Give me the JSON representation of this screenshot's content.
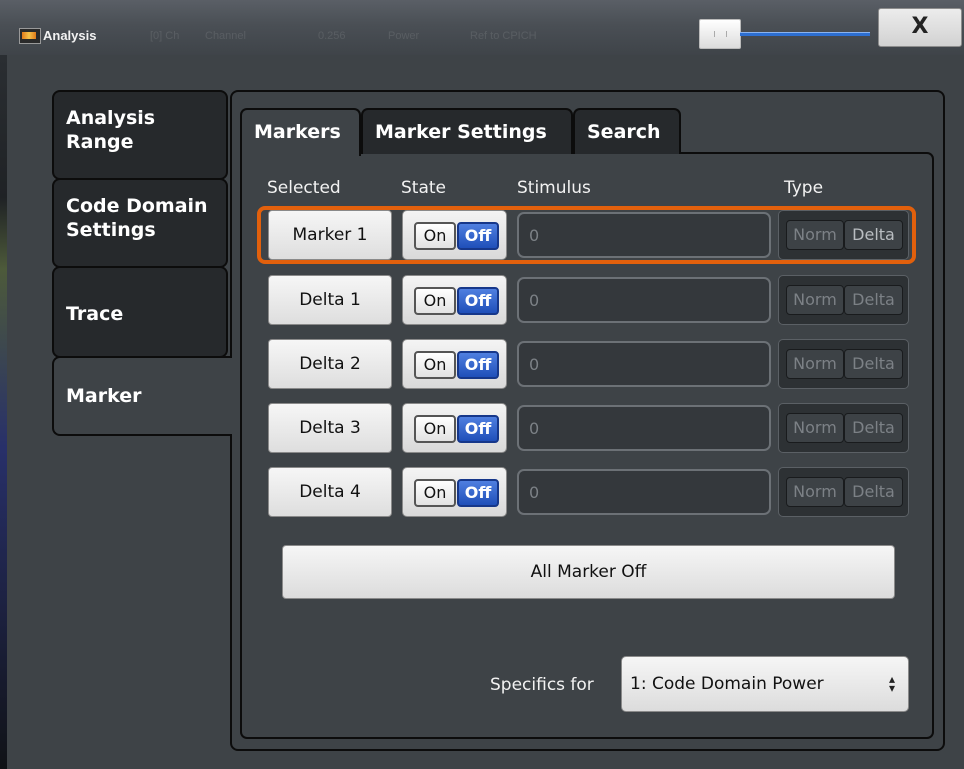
{
  "window": {
    "title": "Analysis",
    "close_label": "X"
  },
  "background_ghost_text": [
    "[0] Ch",
    "Channel",
    "0.256",
    "Power",
    "Ref to CPICH"
  ],
  "side_tabs": [
    {
      "label": "Analysis Range",
      "active": false
    },
    {
      "label": "Code Domain Settings",
      "active": false
    },
    {
      "label": "Trace",
      "active": false
    },
    {
      "label": "Marker",
      "active": true
    }
  ],
  "top_tabs": [
    {
      "label": "Markers",
      "active": true
    },
    {
      "label": "Marker Settings",
      "active": false
    },
    {
      "label": "Search",
      "active": false
    }
  ],
  "columns": {
    "selected": "Selected",
    "state": "State",
    "stimulus": "Stimulus",
    "type": "Type"
  },
  "markers": [
    {
      "name": "Marker 1",
      "on": "On",
      "off": "Off",
      "state": "Off",
      "stimulus": "0",
      "norm": "Norm",
      "delta": "Delta",
      "selected": true
    },
    {
      "name": "Delta 1",
      "on": "On",
      "off": "Off",
      "state": "Off",
      "stimulus": "0",
      "norm": "Norm",
      "delta": "Delta",
      "selected": false
    },
    {
      "name": "Delta 2",
      "on": "On",
      "off": "Off",
      "state": "Off",
      "stimulus": "0",
      "norm": "Norm",
      "delta": "Delta",
      "selected": false
    },
    {
      "name": "Delta 3",
      "on": "On",
      "off": "Off",
      "state": "Off",
      "stimulus": "0",
      "norm": "Norm",
      "delta": "Delta",
      "selected": false
    },
    {
      "name": "Delta 4",
      "on": "On",
      "off": "Off",
      "state": "Off",
      "stimulus": "0",
      "norm": "Norm",
      "delta": "Delta",
      "selected": false
    }
  ],
  "all_marker_off_label": "All Marker Off",
  "specifics": {
    "label": "Specifics for",
    "value": "1: Code Domain Power"
  },
  "colors": {
    "accent": "#e2600c",
    "off_active": "#1f4fb9",
    "panel": "#3e4347",
    "tab_inactive": "#26292c"
  }
}
